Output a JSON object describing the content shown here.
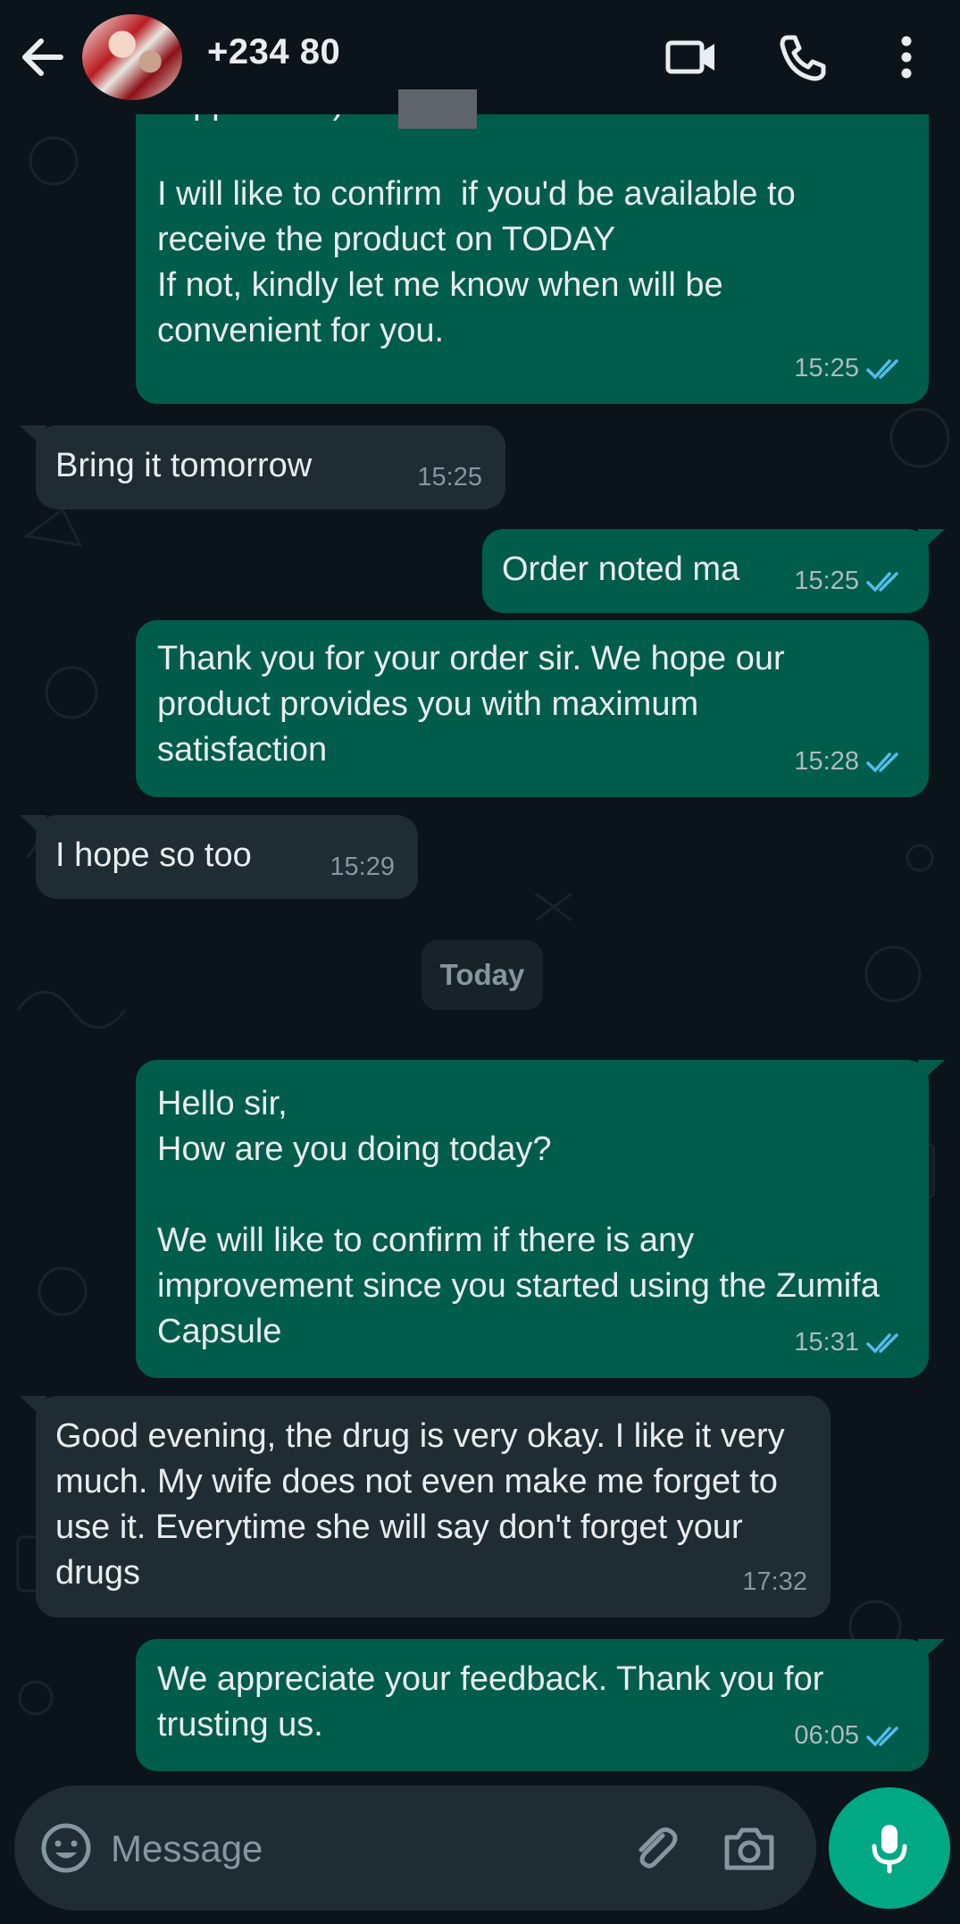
{
  "header": {
    "contact_name": "+234 80",
    "icons": [
      "back-arrow-icon",
      "video-call-icon",
      "voice-call-icon",
      "more-options-icon"
    ]
  },
  "messages": [
    {
      "direction": "out",
      "text": "supplement).\n\nI will like to confirm  if you'd be available to receive the product on TODAY\nIf not, kindly let me know when will be convenient for you.",
      "time": "15:25",
      "status": "read"
    },
    {
      "direction": "in",
      "text": "Bring it tomorrow",
      "time": "15:25"
    },
    {
      "direction": "out",
      "text": "Order noted ma",
      "time": "15:25",
      "status": "read"
    },
    {
      "direction": "out",
      "text": "Thank you for your order sir. We hope our product provides you with maximum satisfaction",
      "time": "15:28",
      "status": "read"
    },
    {
      "direction": "in",
      "text": "I hope so too",
      "time": "15:29"
    },
    {
      "direction": "out",
      "text": "Hello sir,\nHow are you doing today?\n\nWe will like to confirm if there is any improvement since you started using the Zumifa Capsule",
      "time": "15:31",
      "status": "read"
    },
    {
      "direction": "in",
      "text": "Good evening, the drug is very okay. I like it very much. My wife does not even make me forget to use it. Everytime she will say don't forget your drugs",
      "time": "17:32"
    },
    {
      "direction": "out",
      "text": "We appreciate your feedback. Thank you for trusting us.",
      "time": "06:05",
      "status": "read"
    }
  ],
  "date_separator": "Today",
  "composer": {
    "placeholder": "Message",
    "icons": [
      "emoji-icon",
      "attach-icon",
      "camera-icon",
      "microphone-icon"
    ]
  },
  "colors": {
    "background": "#0b141a",
    "outgoing_bubble": "#005c4b",
    "incoming_bubble": "#202c33",
    "read_ticks": "#53bdeb",
    "accent": "#00a884"
  }
}
